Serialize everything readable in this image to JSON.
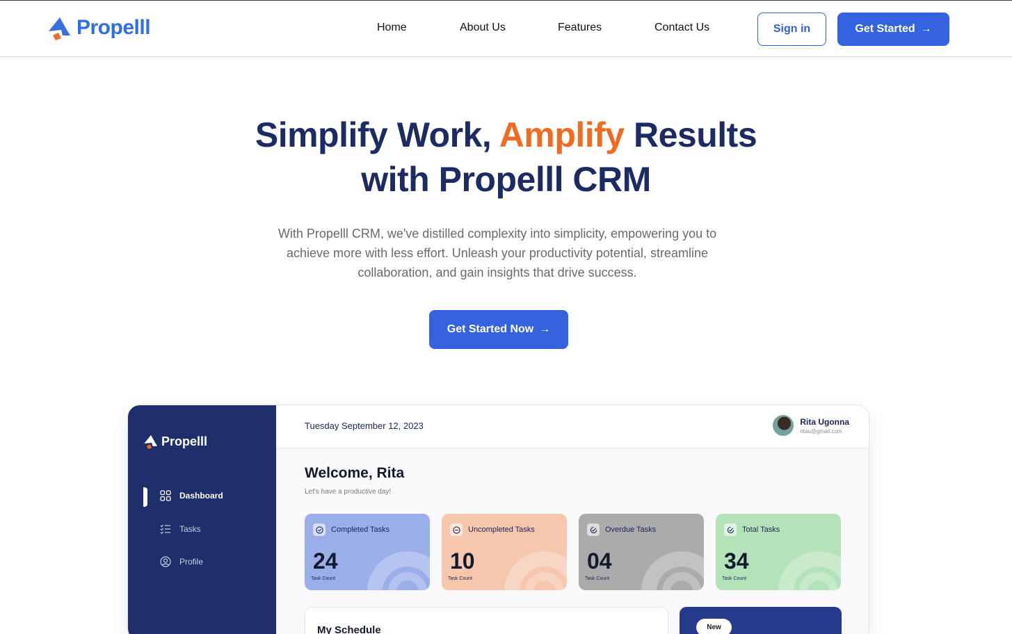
{
  "nav": {
    "brand": "Propelll",
    "links": [
      "Home",
      "About Us",
      "Features",
      "Contact Us"
    ],
    "sign_in": "Sign in",
    "get_started": "Get Started"
  },
  "hero": {
    "title_part1": "Simplify Work, ",
    "title_accent": "Amplify",
    "title_part2": " Results",
    "title_line2": "with Propelll CRM",
    "subtitle": "With Propelll CRM, we've distilled complexity into simplicity, empowering you to achieve more with less effort. Unleash your productivity potential, streamline collaboration, and gain insights that drive success.",
    "cta": "Get Started Now"
  },
  "dashboard": {
    "brand": "Propelll",
    "sidebar": [
      "Dashboard",
      "Tasks",
      "Profile"
    ],
    "date": "Tuesday September 12, 2023",
    "user_name": "Rita Ugonna",
    "user_email": "ritau@gmail.com",
    "welcome": "Welcome, Rita",
    "tagline": "Let's have a productive day!",
    "cards": [
      {
        "title": "Completed Tasks",
        "value": "24",
        "label": "Task Count",
        "color": "#9aaeea"
      },
      {
        "title": "Uncompleted Tasks",
        "value": "10",
        "label": "Task Count",
        "color": "#f6c6ad"
      },
      {
        "title": "Overdue Tasks",
        "value": "04",
        "label": "Task Count",
        "color": "#ababab"
      },
      {
        "title": "Total Tasks",
        "value": "34",
        "label": "Task Count",
        "color": "#b5e3b9"
      }
    ],
    "schedule_title": "My Schedule",
    "new_badge": "New"
  },
  "colors": {
    "primary": "#3563e0",
    "accent": "#f26a1f",
    "navy": "#1e2f6b"
  }
}
